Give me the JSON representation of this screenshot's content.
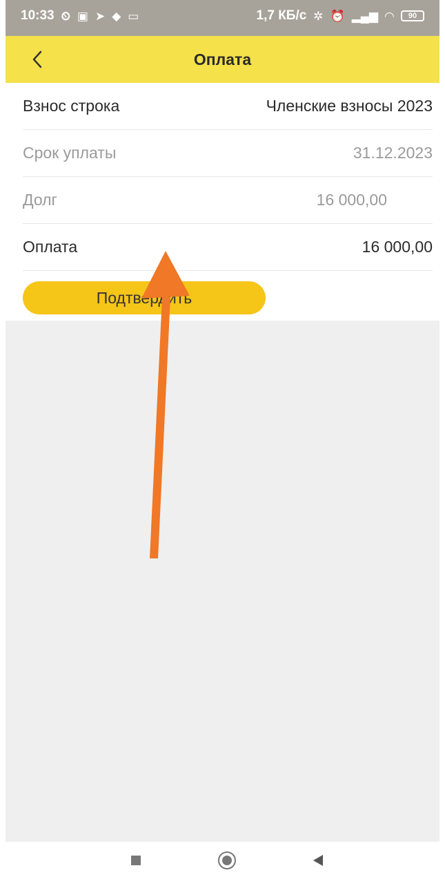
{
  "status_bar": {
    "time": "10:33",
    "network_speed": "1,7 КБ/с",
    "battery": "90",
    "left_icons": [
      "alarm-icon",
      "app-icon",
      "location-icon",
      "app-icon",
      "laptop-icon"
    ],
    "right_icons": [
      "bluetooth-icon",
      "alarm-icon",
      "signal-icon",
      "wifi-icon",
      "battery-icon"
    ]
  },
  "header": {
    "title": "Оплата",
    "back_icon": "chevron-left-icon",
    "background": "#f5e14a"
  },
  "form": {
    "rows": [
      {
        "label": "Взнос строка",
        "value": "Членские взносы 2023"
      },
      {
        "label": "Срок уплаты",
        "value": "31.12.2023"
      },
      {
        "label": "Долг",
        "value": "16 000,00"
      },
      {
        "label": "Оплата",
        "value": "16 000,00"
      }
    ],
    "confirm_label": "Подтвердить"
  },
  "nav": {
    "buttons": [
      "recent-apps-icon",
      "home-icon",
      "back-triangle-icon"
    ]
  },
  "colors": {
    "accent_button": "#f5c518",
    "annotation_arrow": "#f07826",
    "muted_text": "#9a9a9a"
  }
}
